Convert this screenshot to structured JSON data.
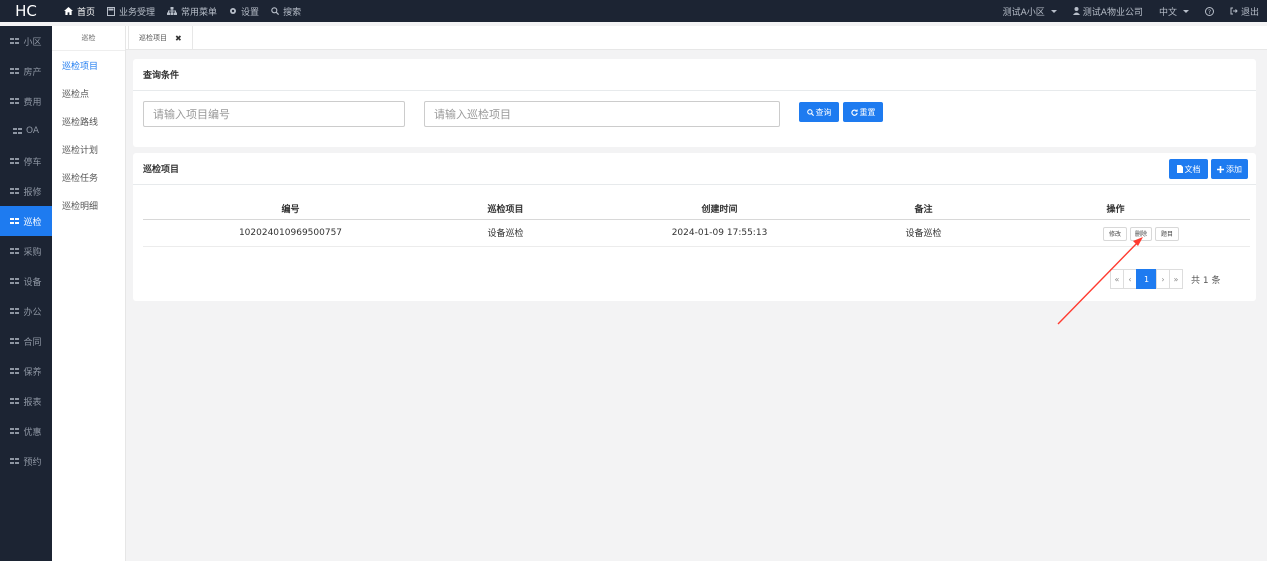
{
  "topbar": {
    "logo": "HC",
    "nav": [
      {
        "icon": "home-icon",
        "label": "首页"
      },
      {
        "icon": "calculator-icon",
        "label": "业务受理"
      },
      {
        "icon": "sitemap-icon",
        "label": "常用菜单"
      },
      {
        "icon": "gear-icon",
        "label": "设置"
      },
      {
        "icon": "search-icon",
        "label": "搜索"
      }
    ],
    "community": "测试A小区",
    "company": "测试A物业公司",
    "language": "中文",
    "help_glyph": "?",
    "logout": "退出"
  },
  "sidebar": {
    "items": [
      "小区",
      "房产",
      "费用",
      "OA",
      "停车",
      "报修",
      "巡检",
      "采购",
      "设备",
      "办公",
      "合同",
      "保养",
      "报表",
      "优惠",
      "预约"
    ],
    "active_index": 6
  },
  "subnav": {
    "header": "巡检",
    "items": [
      "巡检项目",
      "巡检点",
      "巡检路线",
      "巡检计划",
      "巡检任务",
      "巡检明细"
    ],
    "active_index": 0
  },
  "tabs": [
    {
      "label": "巡检项目",
      "close": "✖"
    }
  ],
  "query": {
    "title": "查询条件",
    "code_placeholder": "请输入项目编号",
    "name_placeholder": "请输入巡检项目",
    "search_btn": "查询",
    "reset_btn": "重置"
  },
  "list": {
    "title": "巡检项目",
    "doc_btn": "文档",
    "add_btn": "添加",
    "columns": [
      "编号",
      "巡检项目",
      "创建时间",
      "备注",
      "操作"
    ],
    "rows": [
      {
        "code": "102024010969500757",
        "name": "设备巡检",
        "created": "2024-01-09 17:55:13",
        "remark": "设备巡检",
        "actions": [
          "修改",
          "删除",
          "题目"
        ]
      }
    ]
  },
  "pager": {
    "first": "«",
    "prev": "‹",
    "current": "1",
    "next": "›",
    "last": "»",
    "total": "共 1 条"
  },
  "colors": {
    "accent": "#1e7bf0",
    "dark": "#1c2433",
    "arrow": "#ff3b30"
  }
}
